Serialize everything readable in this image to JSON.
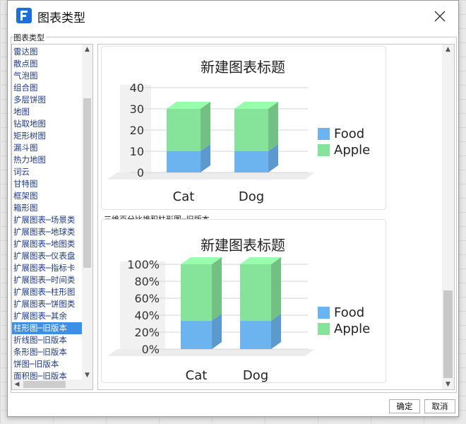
{
  "dialog": {
    "title": "图表类型",
    "group_label": "图表类型",
    "ok_label": "确定",
    "cancel_label": "取消"
  },
  "chart_types": [
    "雷达图",
    "散点图",
    "气泡图",
    "组合图",
    "多层饼图",
    "地图",
    "钻取地图",
    "矩形树图",
    "漏斗图",
    "热力地图",
    "词云",
    "甘特图",
    "框架图",
    "箱形图",
    "扩展图表─场景类",
    "扩展图表─地球类",
    "扩展图表─地图类",
    "扩展图表─仪表盘",
    "扩展图表─指标卡",
    "扩展图表─时间类",
    "扩展图表─柱形图",
    "扩展图表─饼图类",
    "扩展图表─其余",
    "柱形图─旧版本",
    "折线图─旧版本",
    "条形图─旧版本",
    "饼图─旧版本",
    "面积图─旧版本"
  ],
  "selected_index": 23,
  "preview": {
    "caption_2": "三维百分比堆积柱形图─旧版本"
  },
  "chart_data": [
    {
      "type": "bar",
      "title": "新建图表标题",
      "categories": [
        "Cat",
        "Dog"
      ],
      "series": [
        {
          "name": "Food",
          "values": [
            10,
            10
          ]
        },
        {
          "name": "Apple",
          "values": [
            20,
            20
          ]
        }
      ],
      "ylim": [
        0,
        40
      ],
      "yticks": [
        "0",
        "10",
        "20",
        "30",
        "40"
      ],
      "stacked": true,
      "three_d": true,
      "legend": "right",
      "grid": true
    },
    {
      "type": "bar",
      "title": "新建图表标题",
      "categories": [
        "Cat",
        "Dog"
      ],
      "series": [
        {
          "name": "Food",
          "values": [
            33.3,
            33.3
          ]
        },
        {
          "name": "Apple",
          "values": [
            66.7,
            66.7
          ]
        }
      ],
      "ylim": [
        0,
        100
      ],
      "yticks": [
        "0%",
        "20%",
        "40%",
        "60%",
        "80%",
        "100%"
      ],
      "stacked": true,
      "percent": true,
      "three_d": true,
      "legend": "right",
      "grid": true
    }
  ],
  "colors": {
    "food": "#6cb4f0",
    "apple": "#86e39a",
    "selected": "#3c8ee6",
    "list_text": "#1f3a8a"
  }
}
